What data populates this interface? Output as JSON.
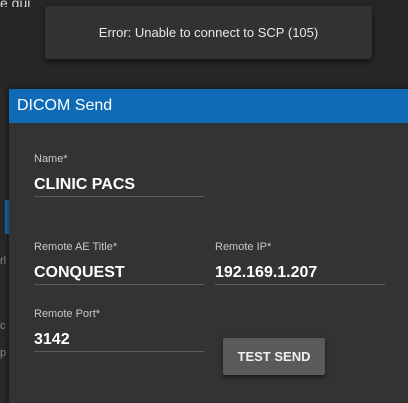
{
  "snackbar": {
    "message": "Error: Unable to connect to SCP (105)"
  },
  "background": {
    "top_partial_text": "e gui"
  },
  "dialog": {
    "title": "DICOM Send",
    "fields": {
      "name": {
        "label": "Name",
        "required_mark": "*",
        "value": "CLINIC PACS"
      },
      "remote_ae_title": {
        "label": "Remote AE Title",
        "required_mark": "*",
        "value": "CONQUEST"
      },
      "remote_ip": {
        "label": "Remote IP",
        "required_mark": "*",
        "value": "192.169.1.207"
      },
      "remote_port": {
        "label": "Remote Port",
        "required_mark": "*",
        "value": "3142"
      }
    },
    "test_send_label": "TEST SEND"
  },
  "colors": {
    "header": "#0f6bb5",
    "dialog_background": "#333333",
    "snackbar_background": "#323232",
    "button_background": "#5a5a5a"
  }
}
